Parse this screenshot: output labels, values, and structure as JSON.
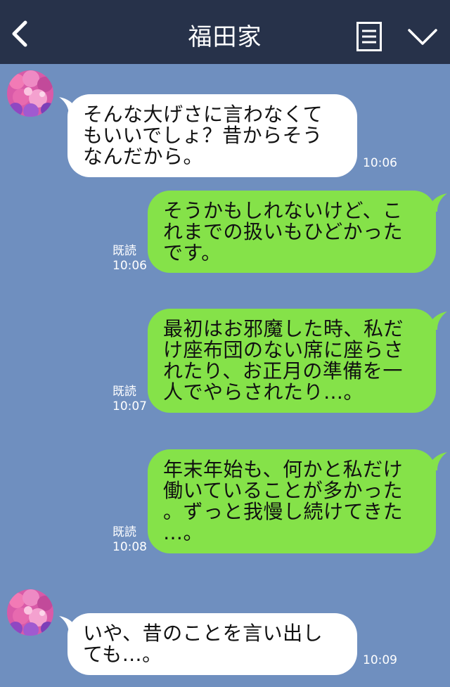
{
  "header": {
    "title": "福田家"
  },
  "messages": [
    {
      "side": "in",
      "text": "そんな大げさに言わなくて\nもいいでしょ？昔からそう\nなんだから。",
      "time": "10:06"
    },
    {
      "side": "out",
      "text": "そうかもしれないけど、こ\nれまでの扱いもひどかった\nです。",
      "read": "既読",
      "time": "10:06"
    },
    {
      "side": "out",
      "text": "最初はお邪魔した時、私だ\nけ座布団のない席に座らさ\nれたり、お正月の準備を一\n人でやらされたり…。",
      "read": "既読",
      "time": "10:07"
    },
    {
      "side": "out",
      "text": "年末年始も、何かと私だけ\n働いていることが多かった\n。ずっと我慢し続けてきた\n…。",
      "read": "既読",
      "time": "10:08"
    },
    {
      "side": "in",
      "text": "いや、昔のことを言い出し\nても…。",
      "time": "10:09"
    }
  ]
}
